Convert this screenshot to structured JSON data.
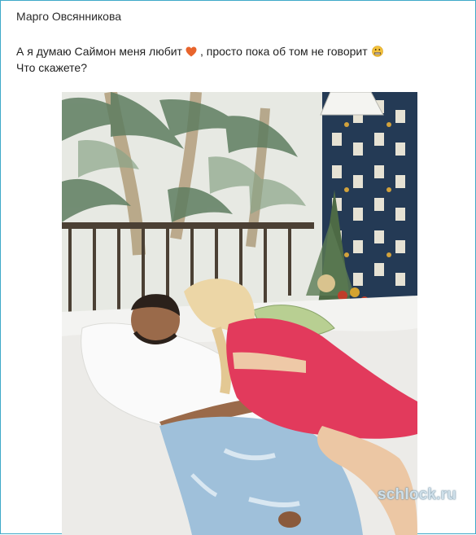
{
  "post": {
    "author": "Марго Овсянникова",
    "text_part1": "А я думаю Саймон меня любит",
    "text_part2": ", просто пока об том не говорит",
    "text_line2": "Что скажете?",
    "emoji_1": "heart-icon",
    "emoji_2": "grimacing-face-icon"
  },
  "watermark": "schlock.ru",
  "colors": {
    "frame_border": "#3fa9c9",
    "heart": "#e8642c",
    "smile": "#f3c23a"
  }
}
